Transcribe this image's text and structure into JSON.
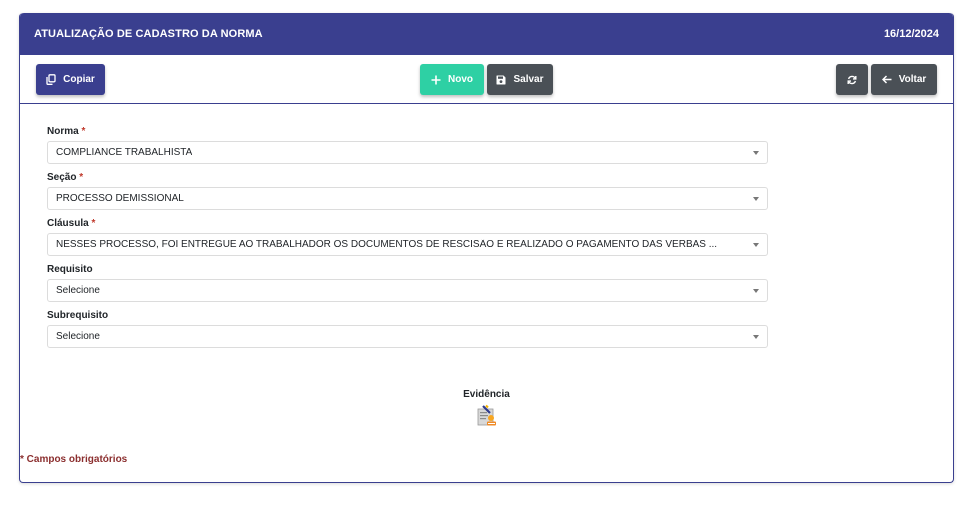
{
  "header": {
    "title": "ATUALIZAÇÃO DE CADASTRO DA NORMA",
    "date": "16/12/2024"
  },
  "toolbar": {
    "copy_label": "Copiar",
    "new_label": "Novo",
    "save_label": "Salvar",
    "back_label": "Voltar"
  },
  "form": {
    "norma": {
      "label": "Norma",
      "required_mark": "*",
      "value": "COMPLIANCE TRABALHISTA"
    },
    "secao": {
      "label": "Seção",
      "required_mark": "*",
      "value": "PROCESSO DEMISSIONAL"
    },
    "clausula": {
      "label": "Cláusula",
      "required_mark": "*",
      "value": "NESSES PROCESSO, FOI ENTREGUE AO TRABALHADOR OS DOCUMENTOS DE RESCISÃO E REALIZADO O PAGAMENTO DAS VERBAS ..."
    },
    "requisito": {
      "label": "Requisito",
      "value": "Selecione"
    },
    "subrequisito": {
      "label": "Subrequisito",
      "value": "Selecione"
    }
  },
  "evidence": {
    "label": "Evidência",
    "icon": "certificate-upload-icon"
  },
  "footer": {
    "required_note": "* Campos obrigatórios"
  },
  "colors": {
    "primary": "#3a3f8f",
    "success": "#2ed0a4",
    "dark": "#4a5056",
    "required": "#c0392b"
  }
}
